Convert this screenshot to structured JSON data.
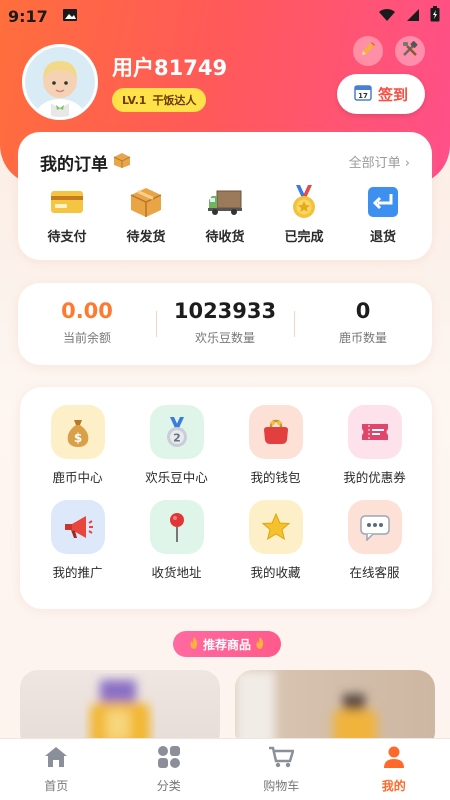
{
  "status_bar": {
    "time": "9:17"
  },
  "profile": {
    "username": "用户81749",
    "level": "LV.1",
    "level_title": "干饭达人"
  },
  "header_actions": {
    "edit_icon": "pencil-icon",
    "settings_icon": "tools-icon",
    "signin_label": "签到"
  },
  "orders": {
    "title": "我的订单",
    "view_all": "全部订单 ›",
    "items": [
      {
        "label": "待支付",
        "icon": "credit-card-icon"
      },
      {
        "label": "待发货",
        "icon": "package-icon"
      },
      {
        "label": "待收货",
        "icon": "truck-icon"
      },
      {
        "label": "已完成",
        "icon": "medal-icon"
      },
      {
        "label": "退货",
        "icon": "return-arrow-icon"
      }
    ]
  },
  "stats": [
    {
      "value": "0.00",
      "label": "当前余额"
    },
    {
      "value": "1023933",
      "label": "欢乐豆数量"
    },
    {
      "value": "0",
      "label": "鹿币数量"
    }
  ],
  "services": [
    {
      "label": "鹿币中心",
      "icon": "money-bag-icon"
    },
    {
      "label": "欢乐豆中心",
      "icon": "silver-medal-icon"
    },
    {
      "label": "我的钱包",
      "icon": "purse-icon"
    },
    {
      "label": "我的优惠券",
      "icon": "ticket-icon"
    },
    {
      "label": "我的推广",
      "icon": "megaphone-icon"
    },
    {
      "label": "收货地址",
      "icon": "map-pin-icon"
    },
    {
      "label": "我的收藏",
      "icon": "star-icon"
    },
    {
      "label": "在线客服",
      "icon": "chat-bubble-icon"
    }
  ],
  "recommend": {
    "label": "推荐商品"
  },
  "tabbar": [
    {
      "label": "首页",
      "icon": "home-icon"
    },
    {
      "label": "分类",
      "icon": "grid-icon"
    },
    {
      "label": "购物车",
      "icon": "cart-icon"
    },
    {
      "label": "我的",
      "icon": "person-icon",
      "active": true
    }
  ],
  "colors": {
    "accent": "#ff6a2b",
    "hero_start": "#ff6e3c",
    "hero_end": "#ff4f8a",
    "badge": "#ffe14a"
  }
}
